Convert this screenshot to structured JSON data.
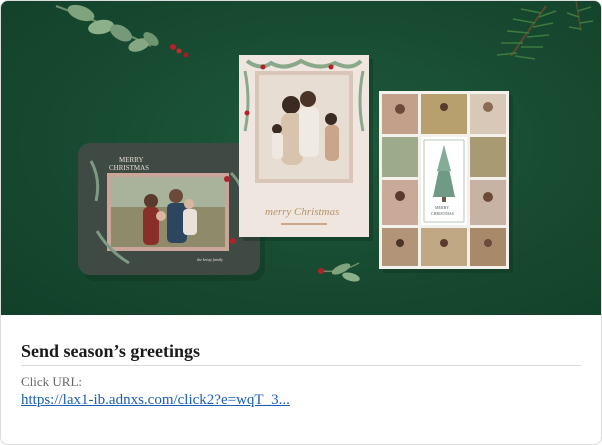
{
  "ad": {
    "title": "Send season’s greetings",
    "url_label": "Click URL:",
    "url_text": "https://lax1-ib.adnxs.com/click2?e=wqT_3..."
  },
  "hero_image": {
    "card_left_text_1": "MERRY",
    "card_left_text_2": "CHRISTMAS",
    "card_left_signature": "the kristy family",
    "card_center_script": "merry Christmas",
    "card_right_text_1": "MERRY",
    "card_right_text_2": "CHRISTMAS"
  },
  "colors": {
    "background_green": "#174a30",
    "link_blue": "#1a5fb4",
    "card_dark": "#3f4a44",
    "card_cream": "#efe6df"
  }
}
